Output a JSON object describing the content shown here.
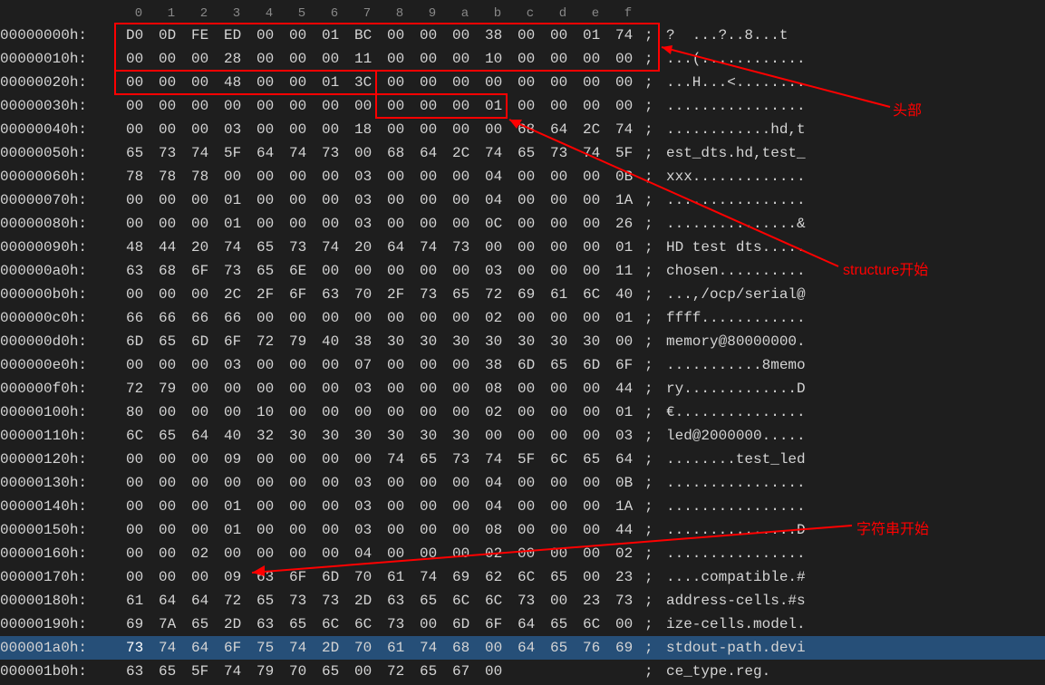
{
  "header_cols": [
    "0",
    "1",
    "2",
    "3",
    "4",
    "5",
    "6",
    "7",
    "8",
    "9",
    "a",
    "b",
    "c",
    "d",
    "e",
    "f"
  ],
  "rows": [
    {
      "offset": "00000000h:",
      "bytes": [
        "D0",
        "0D",
        "FE",
        "ED",
        "00",
        "00",
        "01",
        "BC",
        "00",
        "00",
        "00",
        "38",
        "00",
        "00",
        "01",
        "74"
      ],
      "ascii": "?  ...?..8...t"
    },
    {
      "offset": "00000010h:",
      "bytes": [
        "00",
        "00",
        "00",
        "28",
        "00",
        "00",
        "00",
        "11",
        "00",
        "00",
        "00",
        "10",
        "00",
        "00",
        "00",
        "00"
      ],
      "ascii": "...(............"
    },
    {
      "offset": "00000020h:",
      "bytes": [
        "00",
        "00",
        "00",
        "48",
        "00",
        "00",
        "01",
        "3C",
        "00",
        "00",
        "00",
        "00",
        "00",
        "00",
        "00",
        "00"
      ],
      "ascii": "...H...<........"
    },
    {
      "offset": "00000030h:",
      "bytes": [
        "00",
        "00",
        "00",
        "00",
        "00",
        "00",
        "00",
        "00",
        "00",
        "00",
        "00",
        "01",
        "00",
        "00",
        "00",
        "00"
      ],
      "ascii": "................"
    },
    {
      "offset": "00000040h:",
      "bytes": [
        "00",
        "00",
        "00",
        "03",
        "00",
        "00",
        "00",
        "18",
        "00",
        "00",
        "00",
        "00",
        "68",
        "64",
        "2C",
        "74"
      ],
      "ascii": "............hd,t"
    },
    {
      "offset": "00000050h:",
      "bytes": [
        "65",
        "73",
        "74",
        "5F",
        "64",
        "74",
        "73",
        "00",
        "68",
        "64",
        "2C",
        "74",
        "65",
        "73",
        "74",
        "5F"
      ],
      "ascii": "est_dts.hd,test_"
    },
    {
      "offset": "00000060h:",
      "bytes": [
        "78",
        "78",
        "78",
        "00",
        "00",
        "00",
        "00",
        "03",
        "00",
        "00",
        "00",
        "04",
        "00",
        "00",
        "00",
        "0B"
      ],
      "ascii": "xxx............."
    },
    {
      "offset": "00000070h:",
      "bytes": [
        "00",
        "00",
        "00",
        "01",
        "00",
        "00",
        "00",
        "03",
        "00",
        "00",
        "00",
        "04",
        "00",
        "00",
        "00",
        "1A"
      ],
      "ascii": "................"
    },
    {
      "offset": "00000080h:",
      "bytes": [
        "00",
        "00",
        "00",
        "01",
        "00",
        "00",
        "00",
        "03",
        "00",
        "00",
        "00",
        "0C",
        "00",
        "00",
        "00",
        "26"
      ],
      "ascii": "...............&"
    },
    {
      "offset": "00000090h:",
      "bytes": [
        "48",
        "44",
        "20",
        "74",
        "65",
        "73",
        "74",
        "20",
        "64",
        "74",
        "73",
        "00",
        "00",
        "00",
        "00",
        "01"
      ],
      "ascii": "HD test dts....."
    },
    {
      "offset": "000000a0h:",
      "bytes": [
        "63",
        "68",
        "6F",
        "73",
        "65",
        "6E",
        "00",
        "00",
        "00",
        "00",
        "00",
        "03",
        "00",
        "00",
        "00",
        "11"
      ],
      "ascii": "chosen.........."
    },
    {
      "offset": "000000b0h:",
      "bytes": [
        "00",
        "00",
        "00",
        "2C",
        "2F",
        "6F",
        "63",
        "70",
        "2F",
        "73",
        "65",
        "72",
        "69",
        "61",
        "6C",
        "40"
      ],
      "ascii": "...,/ocp/serial@"
    },
    {
      "offset": "000000c0h:",
      "bytes": [
        "66",
        "66",
        "66",
        "66",
        "00",
        "00",
        "00",
        "00",
        "00",
        "00",
        "00",
        "02",
        "00",
        "00",
        "00",
        "01"
      ],
      "ascii": "ffff............"
    },
    {
      "offset": "000000d0h:",
      "bytes": [
        "6D",
        "65",
        "6D",
        "6F",
        "72",
        "79",
        "40",
        "38",
        "30",
        "30",
        "30",
        "30",
        "30",
        "30",
        "30",
        "00"
      ],
      "ascii": "memory@80000000."
    },
    {
      "offset": "000000e0h:",
      "bytes": [
        "00",
        "00",
        "00",
        "03",
        "00",
        "00",
        "00",
        "07",
        "00",
        "00",
        "00",
        "38",
        "6D",
        "65",
        "6D",
        "6F"
      ],
      "ascii": "...........8memo"
    },
    {
      "offset": "000000f0h:",
      "bytes": [
        "72",
        "79",
        "00",
        "00",
        "00",
        "00",
        "00",
        "03",
        "00",
        "00",
        "00",
        "08",
        "00",
        "00",
        "00",
        "44"
      ],
      "ascii": "ry.............D"
    },
    {
      "offset": "00000100h:",
      "bytes": [
        "80",
        "00",
        "00",
        "00",
        "10",
        "00",
        "00",
        "00",
        "00",
        "00",
        "00",
        "02",
        "00",
        "00",
        "00",
        "01"
      ],
      "ascii": "€..............."
    },
    {
      "offset": "00000110h:",
      "bytes": [
        "6C",
        "65",
        "64",
        "40",
        "32",
        "30",
        "30",
        "30",
        "30",
        "30",
        "30",
        "00",
        "00",
        "00",
        "00",
        "03"
      ],
      "ascii": "led@2000000....."
    },
    {
      "offset": "00000120h:",
      "bytes": [
        "00",
        "00",
        "00",
        "09",
        "00",
        "00",
        "00",
        "00",
        "74",
        "65",
        "73",
        "74",
        "5F",
        "6C",
        "65",
        "64"
      ],
      "ascii": "........test_led"
    },
    {
      "offset": "00000130h:",
      "bytes": [
        "00",
        "00",
        "00",
        "00",
        "00",
        "00",
        "00",
        "03",
        "00",
        "00",
        "00",
        "04",
        "00",
        "00",
        "00",
        "0B"
      ],
      "ascii": "................"
    },
    {
      "offset": "00000140h:",
      "bytes": [
        "00",
        "00",
        "00",
        "01",
        "00",
        "00",
        "00",
        "03",
        "00",
        "00",
        "00",
        "04",
        "00",
        "00",
        "00",
        "1A"
      ],
      "ascii": "................"
    },
    {
      "offset": "00000150h:",
      "bytes": [
        "00",
        "00",
        "00",
        "01",
        "00",
        "00",
        "00",
        "03",
        "00",
        "00",
        "00",
        "08",
        "00",
        "00",
        "00",
        "44"
      ],
      "ascii": "...............D"
    },
    {
      "offset": "00000160h:",
      "bytes": [
        "00",
        "00",
        "02",
        "00",
        "00",
        "00",
        "00",
        "04",
        "00",
        "00",
        "00",
        "02",
        "00",
        "00",
        "00",
        "02"
      ],
      "ascii": "................"
    },
    {
      "offset": "00000170h:",
      "bytes": [
        "00",
        "00",
        "00",
        "09",
        "63",
        "6F",
        "6D",
        "70",
        "61",
        "74",
        "69",
        "62",
        "6C",
        "65",
        "00",
        "23"
      ],
      "ascii": "....compatible.#"
    },
    {
      "offset": "00000180h:",
      "bytes": [
        "61",
        "64",
        "64",
        "72",
        "65",
        "73",
        "73",
        "2D",
        "63",
        "65",
        "6C",
        "6C",
        "73",
        "00",
        "23",
        "73"
      ],
      "ascii": "address-cells.#s"
    },
    {
      "offset": "00000190h:",
      "bytes": [
        "69",
        "7A",
        "65",
        "2D",
        "63",
        "65",
        "6C",
        "6C",
        "73",
        "00",
        "6D",
        "6F",
        "64",
        "65",
        "6C",
        "00"
      ],
      "ascii": "ize-cells.model."
    },
    {
      "offset": "000001a0h:",
      "bytes": [
        "73",
        "74",
        "64",
        "6F",
        "75",
        "74",
        "2D",
        "70",
        "61",
        "74",
        "68",
        "00",
        "64",
        "65",
        "76",
        "69"
      ],
      "ascii": "stdout-path.devi",
      "highlight": true
    },
    {
      "offset": "000001b0h:",
      "bytes": [
        "63",
        "65",
        "5F",
        "74",
        "79",
        "70",
        "65",
        "00",
        "72",
        "65",
        "67",
        "00"
      ],
      "ascii": "ce_type.reg."
    }
  ],
  "annotations": {
    "label1": "头部",
    "label2": "structure开始",
    "label3": "字符串开始"
  }
}
